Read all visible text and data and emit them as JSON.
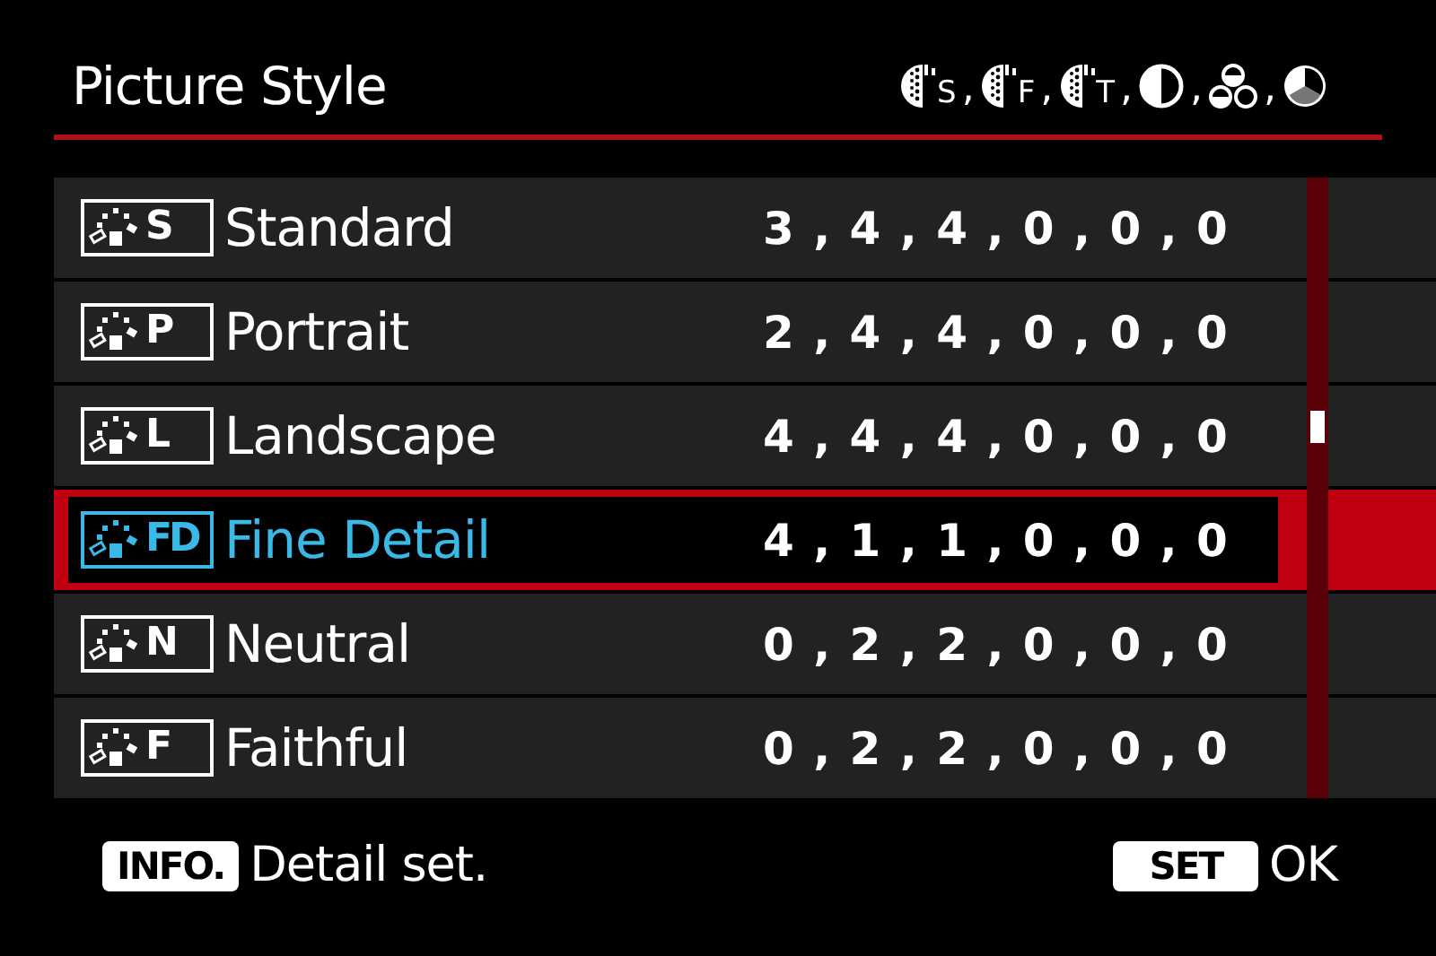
{
  "header": {
    "title": "Picture Style",
    "parameter_icons": [
      {
        "kind": "sharpness",
        "sub": "S",
        "separator": ","
      },
      {
        "kind": "sharpness",
        "sub": "F",
        "separator": ","
      },
      {
        "kind": "sharpness",
        "sub": "T",
        "separator": ","
      },
      {
        "kind": "contrast",
        "separator": ","
      },
      {
        "kind": "saturation",
        "separator": ","
      },
      {
        "kind": "tone"
      }
    ]
  },
  "styles": [
    {
      "badge": "S",
      "name": "Standard",
      "values": "3 , 4 , 4 , 0 , 0 , 0",
      "selected": false
    },
    {
      "badge": "P",
      "name": "Portrait",
      "values": "2 , 4 , 4 , 0 , 0 , 0",
      "selected": false
    },
    {
      "badge": "L",
      "name": "Landscape",
      "values": "4 , 4 , 4 , 0 , 0 , 0",
      "selected": false
    },
    {
      "badge": "FD",
      "name": "Fine Detail",
      "values": "4 , 1 , 1 , 0 , 0 , 0",
      "selected": true
    },
    {
      "badge": "N",
      "name": "Neutral",
      "values": "0 , 2 , 2 , 0 , 0 , 0",
      "selected": false
    },
    {
      "badge": "F",
      "name": "Faithful",
      "values": "0 , 2 , 2 , 0 , 0 , 0",
      "selected": false
    }
  ],
  "footer": [
    {
      "key": "INFO.",
      "action": "Detail set."
    },
    {
      "key": "SET",
      "action": "OK"
    }
  ]
}
